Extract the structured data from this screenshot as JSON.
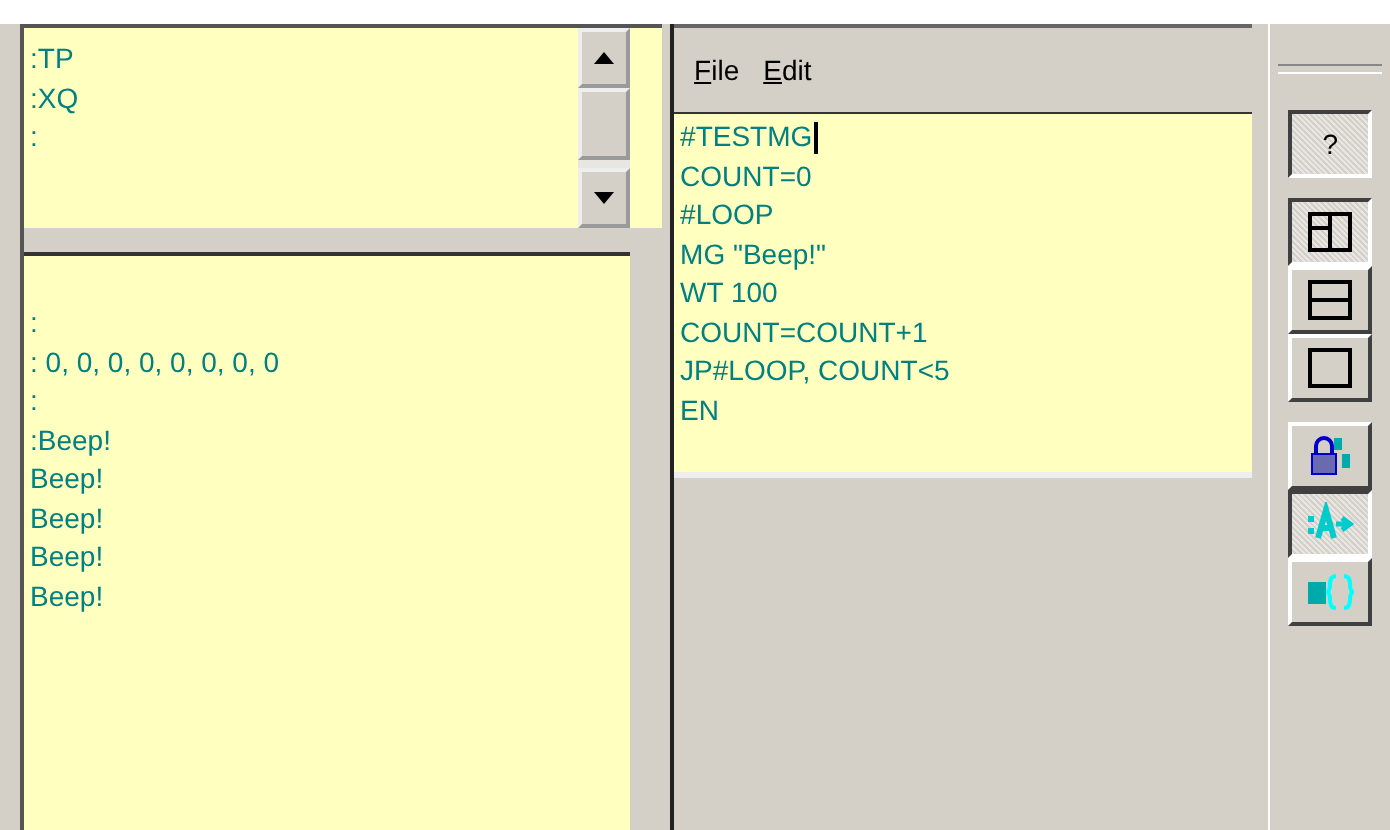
{
  "command_box": {
    "lines": [
      ":TP",
      ":XQ",
      ":"
    ]
  },
  "terminal": {
    "lines": [
      ":",
      ": 0, 0, 0, 0, 0, 0, 0, 0",
      ":",
      ":Beep!",
      "Beep!",
      "Beep!",
      "Beep!",
      "Beep!"
    ]
  },
  "editor": {
    "menu": [
      {
        "label": "File"
      },
      {
        "label": "Edit"
      }
    ],
    "lines": [
      "#TESTMG",
      "COUNT=0",
      "#LOOP",
      "MG \"Beep!\"",
      "WT 100",
      "COUNT=COUNT+1",
      "JP#LOOP, COUNT<5",
      "EN"
    ]
  },
  "toolbar": [
    {
      "kind": "help",
      "label": "?",
      "pressed": true
    },
    {
      "kind": "split-vertical",
      "pressed": true
    },
    {
      "kind": "split-horizontal",
      "pressed": false
    },
    {
      "kind": "single-pane",
      "pressed": false
    },
    {
      "kind": "caps-lock",
      "pressed": false
    },
    {
      "kind": "command-arrow",
      "pressed": true
    },
    {
      "kind": "editor-braces",
      "pressed": false
    }
  ]
}
